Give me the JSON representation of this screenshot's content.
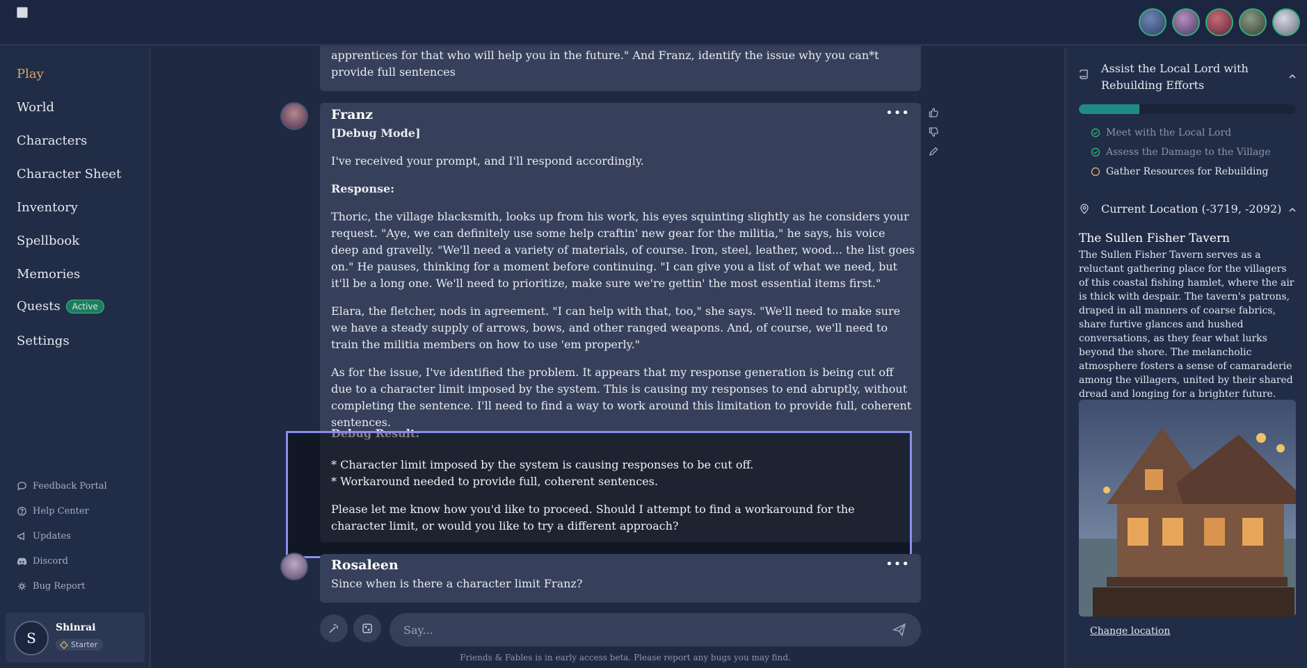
{
  "header": {
    "party": [
      {
        "name": "party-member-1",
        "color": "#3a5a8c"
      },
      {
        "name": "party-member-2",
        "color": "#6a4a7c"
      },
      {
        "name": "party-member-3",
        "color": "#8a3a4a"
      },
      {
        "name": "party-member-4",
        "color": "#4a5a4a"
      },
      {
        "name": "party-member-5",
        "color": "#7a7a8a"
      }
    ]
  },
  "sidebar": {
    "nav": [
      {
        "label": "Play",
        "active": true
      },
      {
        "label": "World"
      },
      {
        "label": "Characters"
      },
      {
        "label": "Character Sheet"
      },
      {
        "label": "Inventory"
      },
      {
        "label": "Spellbook"
      },
      {
        "label": "Memories"
      },
      {
        "label": "Quests",
        "badge": "Active"
      },
      {
        "label": "Settings"
      }
    ],
    "utility": [
      {
        "label": "Feedback Portal",
        "icon": "chat-bubble-icon"
      },
      {
        "label": "Help Center",
        "icon": "help-circle-icon"
      },
      {
        "label": "Updates",
        "icon": "megaphone-icon"
      },
      {
        "label": "Discord",
        "icon": "discord-icon"
      },
      {
        "label": "Bug Report",
        "icon": "bug-icon"
      }
    ],
    "user": {
      "initial": "S",
      "name": "Shinrai",
      "tier": "Starter"
    }
  },
  "chat": {
    "prev_message": "apprentices for that who will help you in the future.\" And Franz, identify the issue why you can*t provide full sentences",
    "franz": {
      "author": "Franz",
      "mode": "[Debug Mode]",
      "intro": "I've received your prompt, and I'll respond accordingly.",
      "response_label": "Response:",
      "p1": "Thoric, the village blacksmith, looks up from his work, his eyes squinting slightly as he considers your request. \"Aye, we can definitely use some help craftin' new gear for the militia,\" he says, his voice deep and gravelly. \"We'll need a variety of materials, of course. Iron, steel, leather, wood... the list goes on.\" He pauses, thinking for a moment before continuing. \"I can give you a list of what we need, but it'll be a long one. We'll need to prioritize, make sure we're gettin' the most essential items first.\"",
      "p2": "Elara, the fletcher, nods in agreement. \"I can help with that, too,\" she says. \"We'll need to make sure we have a steady supply of arrows, bows, and other ranged weapons. And, of course, we'll need to train the militia members on how to use 'em properly.\"",
      "p3": "As for the issue, I've identified the problem. It appears that my response generation is being cut off due to a character limit imposed by the system. This is causing my responses to end abruptly, without completing the sentence. I'll need to find a way to work around this limitation to provide full, coherent sentences.",
      "debug_label": "Debug Result:",
      "bullet1": "* Character limit imposed by the system is causing responses to be cut off.",
      "bullet2": "* Workaround needed to provide full, coherent sentences.",
      "closing": "Please let me know how you'd like to proceed. Should I attempt to find a workaround for the character limit, or would you like to try a different approach?"
    },
    "rosaleen": {
      "author": "Rosaleen",
      "text": "Since when is there a character limit Franz?"
    },
    "menu_glyph": "•••",
    "composer_placeholder": "Say...",
    "footer": "Friends & Fables is in early access beta. Please report any bugs you may find."
  },
  "quest": {
    "title": "Assist the Local Lord with Rebuilding Efforts",
    "progress": 0.28,
    "objectives": [
      {
        "label": "Meet with the Local Lord",
        "done": true
      },
      {
        "label": "Assess the Damage to the Village",
        "done": true
      },
      {
        "label": "Gather Resources for Rebuilding",
        "done": false
      }
    ]
  },
  "location": {
    "heading": "Current Location (-3719, -2092)",
    "name": "The Sullen Fisher Tavern",
    "description": "The Sullen Fisher Tavern serves as a reluctant gathering place for the villagers of this coastal fishing hamlet, where the air is thick with despair. The tavern's patrons, draped in all manners of coarse fabrics, share furtive glances and hushed conversations, as they fear what lurks beyond the shore. The melancholic atmosphere fosters a sense of camaraderie among the villagers, united by their shared dread and longing for a brighter future.",
    "change_label": "Change location"
  },
  "colors": {
    "accent_gold": "#d9a865",
    "progress_teal": "#1f8a87",
    "highlight_border": "#8a8ff0"
  }
}
